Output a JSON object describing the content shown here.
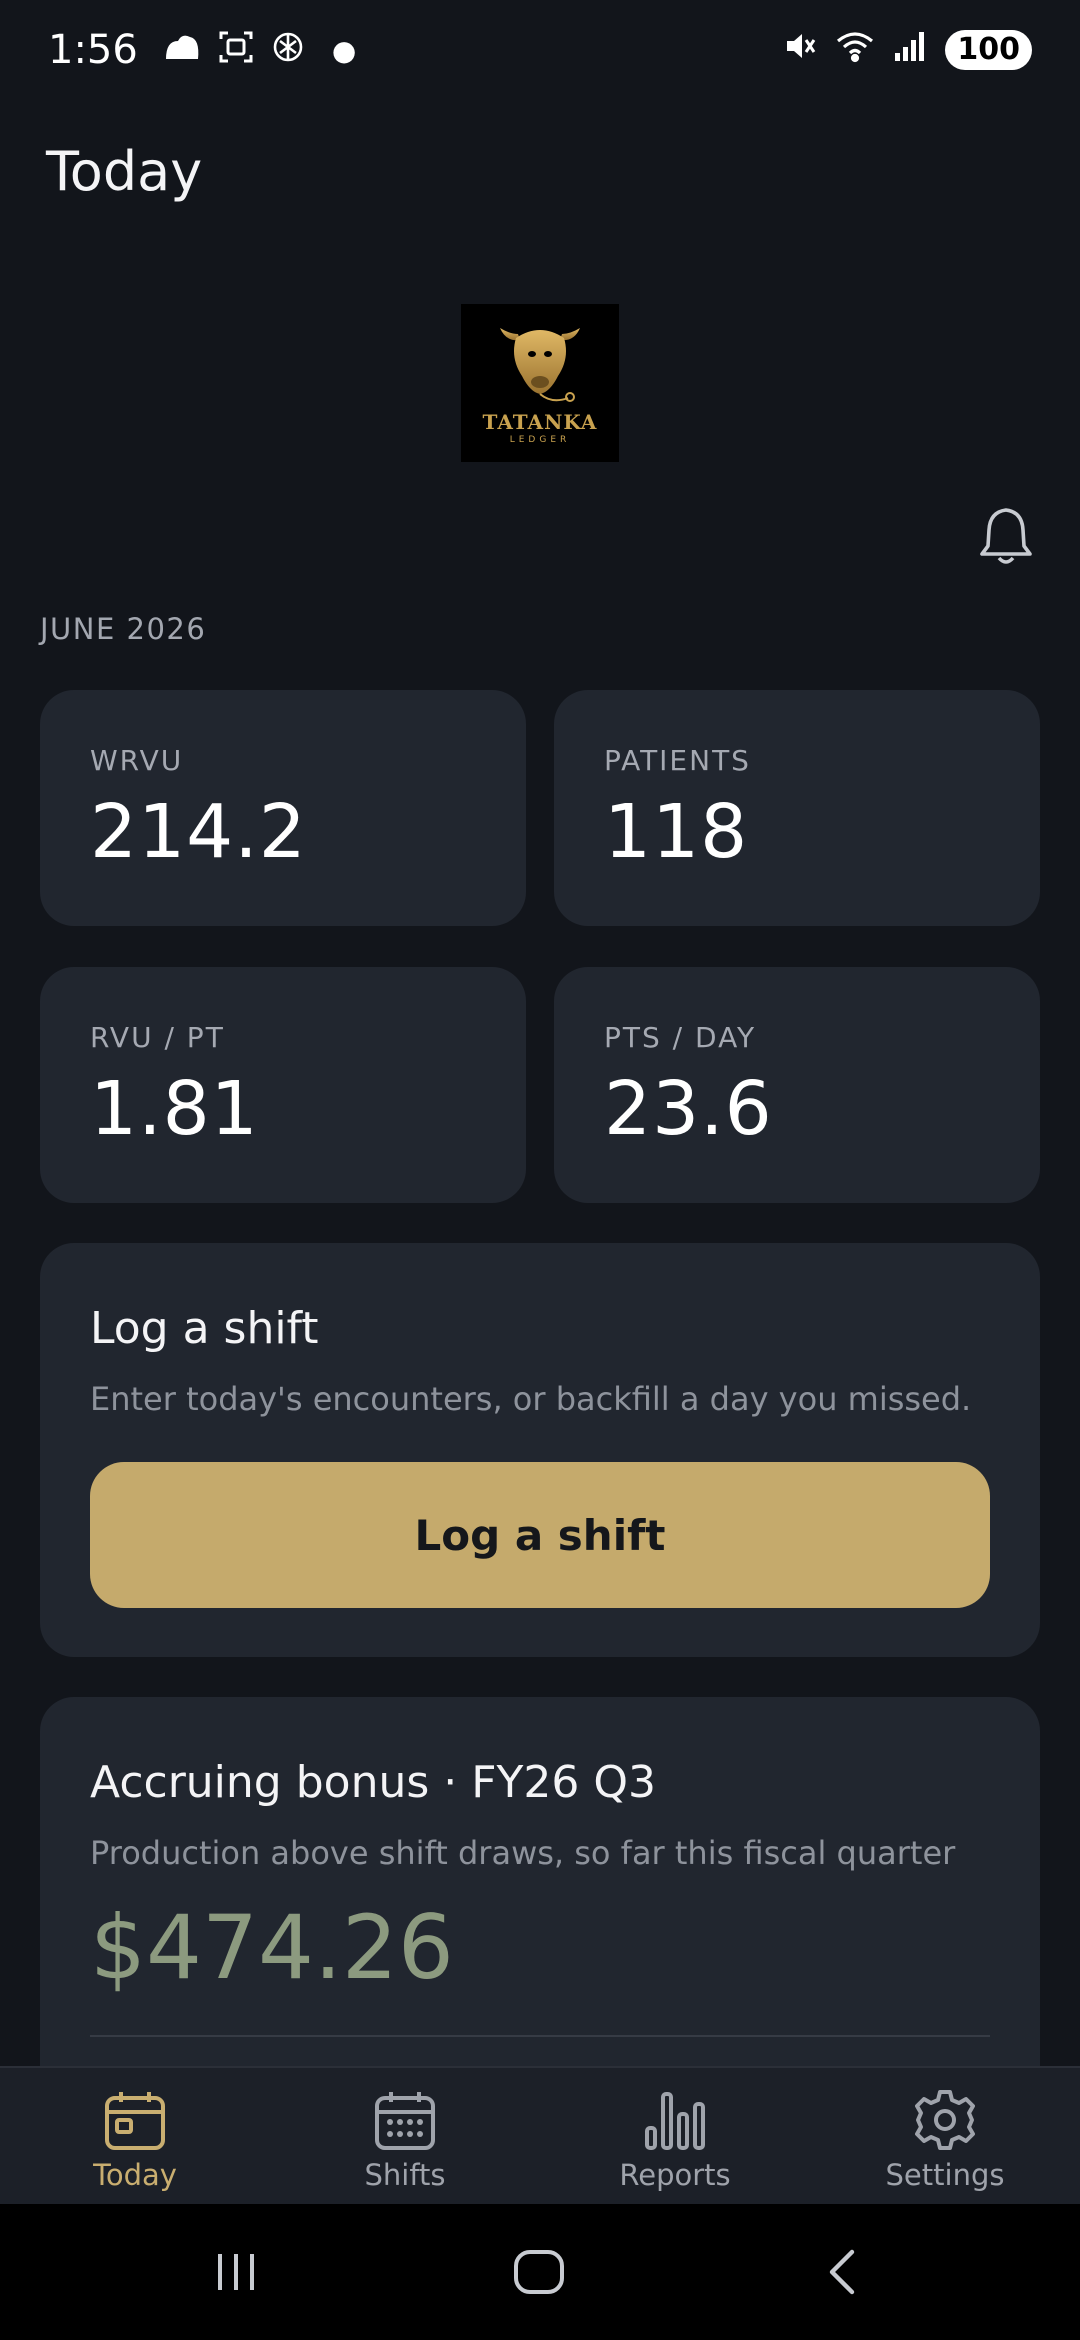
{
  "status_bar": {
    "time": "1:56",
    "battery": "100",
    "icons": [
      "cloud-icon",
      "screenshot-icon",
      "openai-icon",
      "notification-dot",
      "mute-icon",
      "wifi-icon",
      "signal-icon"
    ]
  },
  "header": {
    "title": "Today"
  },
  "logo": {
    "name": "TATANKA",
    "subtitle": "LEDGER",
    "icon": "bison-icon"
  },
  "notifications": {
    "icon": "bell-icon"
  },
  "period": {
    "label": "JUNE 2026"
  },
  "stats": [
    {
      "label": "WRVU",
      "value": "214.2"
    },
    {
      "label": "PATIENTS",
      "value": "118"
    },
    {
      "label": "RVU / PT",
      "value": "1.81"
    },
    {
      "label": "PTS / DAY",
      "value": "23.6"
    }
  ],
  "log_shift": {
    "title": "Log a shift",
    "subtitle": "Enter today's encounters, or backfill a day you missed.",
    "button_label": "Log a shift"
  },
  "bonus": {
    "title": "Accruing bonus · FY26 Q3",
    "subtitle": "Production above shift draws, so far this fiscal quarter",
    "amount": "$474.26"
  },
  "bottom_nav": {
    "items": [
      {
        "label": "Today",
        "icon": "calendar-icon",
        "active": true
      },
      {
        "label": "Shifts",
        "icon": "calendar-grid-icon",
        "active": false
      },
      {
        "label": "Reports",
        "icon": "bar-chart-icon",
        "active": false
      },
      {
        "label": "Settings",
        "icon": "gear-icon",
        "active": false
      }
    ]
  },
  "colors": {
    "background": "#12151b",
    "card": "#21262f",
    "accent": "#c5aa6c",
    "bonus_green": "#8c9a7f"
  }
}
